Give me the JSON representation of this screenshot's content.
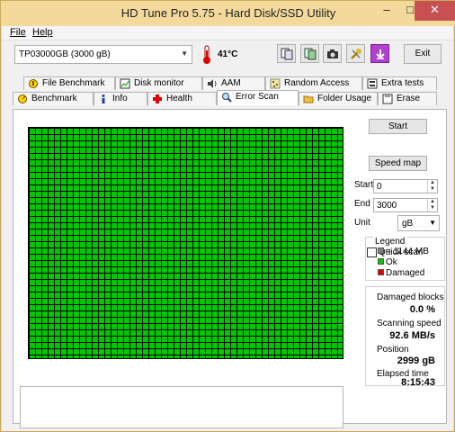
{
  "window": {
    "title": "HD Tune Pro 5.75 - Hard Disk/SSD Utility",
    "minimize": "–",
    "maximize": "□",
    "close": "✕"
  },
  "menu": {
    "file": "File",
    "help": "Help"
  },
  "toolbar": {
    "drive": "TP03000GB (3000 gB)",
    "temperature": "41°C",
    "exit_label": "Exit"
  },
  "tabs_top": [
    {
      "label": "File Benchmark",
      "icon": "file-benchmark-icon"
    },
    {
      "label": "Disk monitor",
      "icon": "disk-monitor-icon"
    },
    {
      "label": "AAM",
      "icon": "speaker-icon"
    },
    {
      "label": "Random Access",
      "icon": "random-access-icon"
    },
    {
      "label": "Extra tests",
      "icon": "extra-tests-icon"
    }
  ],
  "tabs_bottom": [
    {
      "label": "Benchmark",
      "icon": "benchmark-icon"
    },
    {
      "label": "Info",
      "icon": "info-icon"
    },
    {
      "label": "Health",
      "icon": "health-icon"
    },
    {
      "label": "Error Scan",
      "icon": "magnifier-icon"
    },
    {
      "label": "Folder Usage",
      "icon": "folder-icon"
    },
    {
      "label": "Erase",
      "icon": "erase-icon"
    }
  ],
  "controls": {
    "start_button": "Start",
    "quick_scan": "Quick scan",
    "quick_scan_checked": false,
    "speed_map": "Speed map",
    "start_label": "Start",
    "start_value": "0",
    "end_label": "End",
    "end_value": "3000",
    "unit_label": "Unit",
    "unit_value": "gB"
  },
  "legend": {
    "title": "Legend",
    "block": "= 1144 MB",
    "ok": "Ok",
    "damaged": "Damaged",
    "colors": {
      "block": "#808080",
      "ok": "#00c800",
      "damaged": "#e00000"
    }
  },
  "stats": {
    "damaged_blocks_label": "Damaged blocks",
    "damaged_blocks_value": "0.0 %",
    "scanning_speed_label": "Scanning speed",
    "scanning_speed_value": "92.6 MB/s",
    "position_label": "Position",
    "position_value": "2999 gB",
    "elapsed_label": "Elapsed time",
    "elapsed_value": "8:15:43"
  }
}
